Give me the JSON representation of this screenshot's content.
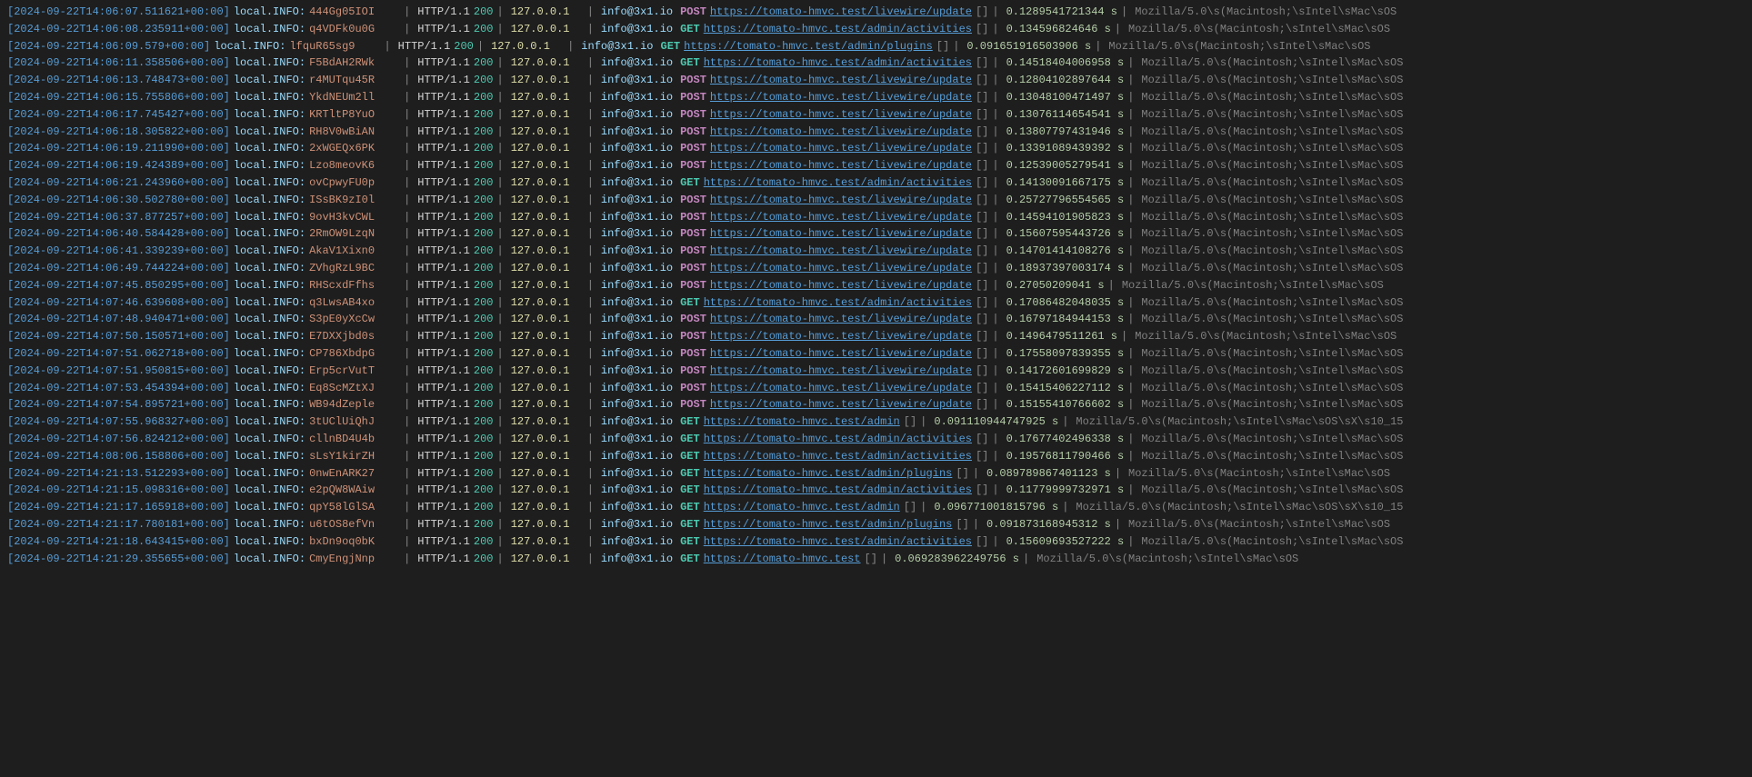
{
  "logs": [
    {
      "timestamp": "[2024-09-22T14:06:07.511621+00:00]",
      "level": "local.INFO:",
      "session": "444Gg05IOI",
      "http": "HTTP/1.1",
      "status": "200",
      "ip": "127.0.0.1",
      "domain": "info@3x1.io",
      "method": "POST",
      "url": "https://tomato-hmvc.test/livewire/update",
      "timing": "0.1289541721344 s",
      "ua": "Mozilla/5.0\\s(Macintosh;\\sIntel\\sMac\\sOS"
    },
    {
      "timestamp": "[2024-09-22T14:06:08.235911+00:00]",
      "level": "local.INFO:",
      "session": "q4VDFk0u0G",
      "http": "HTTP/1.1",
      "status": "200",
      "ip": "127.0.0.1",
      "domain": "info@3x1.io",
      "method": "GET",
      "url": "https://tomato-hmvc.test/admin/activities",
      "timing": "0.134596824646 s",
      "ua": "Mozilla/5.0\\s(Macintosh;\\sIntel\\sMac\\sOS"
    },
    {
      "timestamp": "[2024-09-22T14:06:09.579+00:00]",
      "level": "local.INFO:",
      "session": "lfquR65sg9",
      "http": "HTTP/1.1",
      "status": "200",
      "ip": "127.0.0.1",
      "domain": "info@3x1.io",
      "method": "GET",
      "url": "https://tomato-hmvc.test/admin/plugins",
      "timing": "0.091651916503906 s",
      "ua": "Mozilla/5.0\\s(Macintosh;\\sIntel\\sMac\\sOS"
    },
    {
      "timestamp": "[2024-09-22T14:06:11.358506+00:00]",
      "level": "local.INFO:",
      "session": "F5BdAH2RWk",
      "http": "HTTP/1.1",
      "status": "200",
      "ip": "127.0.0.1",
      "domain": "info@3x1.io",
      "method": "GET",
      "url": "https://tomato-hmvc.test/admin/activities",
      "timing": "0.14518404006958 s",
      "ua": "Mozilla/5.0\\s(Macintosh;\\sIntel\\sMac\\sOS"
    },
    {
      "timestamp": "[2024-09-22T14:06:13.748473+00:00]",
      "level": "local.INFO:",
      "session": "r4MUTqu45R",
      "http": "HTTP/1.1",
      "status": "200",
      "ip": "127.0.0.1",
      "domain": "info@3x1.io",
      "method": "POST",
      "url": "https://tomato-hmvc.test/livewire/update",
      "timing": "0.12804102897644 s",
      "ua": "Mozilla/5.0\\s(Macintosh;\\sIntel\\sMac\\sOS"
    },
    {
      "timestamp": "[2024-09-22T14:06:15.755806+00:00]",
      "level": "local.INFO:",
      "session": "YkdNEUm2ll",
      "http": "HTTP/1.1",
      "status": "200",
      "ip": "127.0.0.1",
      "domain": "info@3x1.io",
      "method": "POST",
      "url": "https://tomato-hmvc.test/livewire/update",
      "timing": "0.13048100471497 s",
      "ua": "Mozilla/5.0\\s(Macintosh;\\sIntel\\sMac\\sOS"
    },
    {
      "timestamp": "[2024-09-22T14:06:17.745427+00:00]",
      "level": "local.INFO:",
      "session": "KRTltP8YuO",
      "http": "HTTP/1.1",
      "status": "200",
      "ip": "127.0.0.1",
      "domain": "info@3x1.io",
      "method": "POST",
      "url": "https://tomato-hmvc.test/livewire/update",
      "timing": "0.13076114654541 s",
      "ua": "Mozilla/5.0\\s(Macintosh;\\sIntel\\sMac\\sOS"
    },
    {
      "timestamp": "[2024-09-22T14:06:18.305822+00:00]",
      "level": "local.INFO:",
      "session": "RH8V0wBiAN",
      "http": "HTTP/1.1",
      "status": "200",
      "ip": "127.0.0.1",
      "domain": "info@3x1.io",
      "method": "POST",
      "url": "https://tomato-hmvc.test/livewire/update",
      "timing": "0.13807797431946 s",
      "ua": "Mozilla/5.0\\s(Macintosh;\\sIntel\\sMac\\sOS"
    },
    {
      "timestamp": "[2024-09-22T14:06:19.211990+00:00]",
      "level": "local.INFO:",
      "session": "2xWGEQx6PK",
      "http": "HTTP/1.1",
      "status": "200",
      "ip": "127.0.0.1",
      "domain": "info@3x1.io",
      "method": "POST",
      "url": "https://tomato-hmvc.test/livewire/update",
      "timing": "0.13391089439392 s",
      "ua": "Mozilla/5.0\\s(Macintosh;\\sIntel\\sMac\\sOS"
    },
    {
      "timestamp": "[2024-09-22T14:06:19.424389+00:00]",
      "level": "local.INFO:",
      "session": "Lzo8meovK6",
      "http": "HTTP/1.1",
      "status": "200",
      "ip": "127.0.0.1",
      "domain": "info@3x1.io",
      "method": "POST",
      "url": "https://tomato-hmvc.test/livewire/update",
      "timing": "0.12539005279541 s",
      "ua": "Mozilla/5.0\\s(Macintosh;\\sIntel\\sMac\\sOS"
    },
    {
      "timestamp": "[2024-09-22T14:06:21.243960+00:00]",
      "level": "local.INFO:",
      "session": "ovCpwyFU0p",
      "http": "HTTP/1.1",
      "status": "200",
      "ip": "127.0.0.1",
      "domain": "info@3x1.io",
      "method": "GET",
      "url": "https://tomato-hmvc.test/admin/activities",
      "timing": "0.14130091667175 s",
      "ua": "Mozilla/5.0\\s(Macintosh;\\sIntel\\sMac\\sOS"
    },
    {
      "timestamp": "[2024-09-22T14:06:30.502780+00:00]",
      "level": "local.INFO:",
      "session": "ISsBK9zI0l",
      "http": "HTTP/1.1",
      "status": "200",
      "ip": "127.0.0.1",
      "domain": "info@3x1.io",
      "method": "POST",
      "url": "https://tomato-hmvc.test/livewire/update",
      "timing": "0.25727796554565 s",
      "ua": "Mozilla/5.0\\s(Macintosh;\\sIntel\\sMac\\sOS"
    },
    {
      "timestamp": "[2024-09-22T14:06:37.877257+00:00]",
      "level": "local.INFO:",
      "session": "9ovH3kvCWL",
      "http": "HTTP/1.1",
      "status": "200",
      "ip": "127.0.0.1",
      "domain": "info@3x1.io",
      "method": "POST",
      "url": "https://tomato-hmvc.test/livewire/update",
      "timing": "0.14594101905823 s",
      "ua": "Mozilla/5.0\\s(Macintosh;\\sIntel\\sMac\\sOS"
    },
    {
      "timestamp": "[2024-09-22T14:06:40.584428+00:00]",
      "level": "local.INFO:",
      "session": "2RmOW9LzqN",
      "http": "HTTP/1.1",
      "status": "200",
      "ip": "127.0.0.1",
      "domain": "info@3x1.io",
      "method": "POST",
      "url": "https://tomato-hmvc.test/livewire/update",
      "timing": "0.15607595443726 s",
      "ua": "Mozilla/5.0\\s(Macintosh;\\sIntel\\sMac\\sOS"
    },
    {
      "timestamp": "[2024-09-22T14:06:41.339239+00:00]",
      "level": "local.INFO:",
      "session": "AkaV1Xixn0",
      "http": "HTTP/1.1",
      "status": "200",
      "ip": "127.0.0.1",
      "domain": "info@3x1.io",
      "method": "POST",
      "url": "https://tomato-hmvc.test/livewire/update",
      "timing": "0.14701414108276 s",
      "ua": "Mozilla/5.0\\s(Macintosh;\\sIntel\\sMac\\sOS"
    },
    {
      "timestamp": "[2024-09-22T14:06:49.744224+00:00]",
      "level": "local.INFO:",
      "session": "ZVhgRzL9BC",
      "http": "HTTP/1.1",
      "status": "200",
      "ip": "127.0.0.1",
      "domain": "info@3x1.io",
      "method": "POST",
      "url": "https://tomato-hmvc.test/livewire/update",
      "timing": "0.18937397003174 s",
      "ua": "Mozilla/5.0\\s(Macintosh;\\sIntel\\sMac\\sOS"
    },
    {
      "timestamp": "[2024-09-22T14:07:45.850295+00:00]",
      "level": "local.INFO:",
      "session": "RHScxdFfhs",
      "http": "HTTP/1.1",
      "status": "200",
      "ip": "127.0.0.1",
      "domain": "info@3x1.io",
      "method": "POST",
      "url": "https://tomato-hmvc.test/livewire/update",
      "timing": "0.27050209041 s",
      "ua": "Mozilla/5.0\\s(Macintosh;\\sIntel\\sMac\\sOS"
    },
    {
      "timestamp": "[2024-09-22T14:07:46.639608+00:00]",
      "level": "local.INFO:",
      "session": "q3LwsAB4xo",
      "http": "HTTP/1.1",
      "status": "200",
      "ip": "127.0.0.1",
      "domain": "info@3x1.io",
      "method": "GET",
      "url": "https://tomato-hmvc.test/admin/activities",
      "timing": "0.17086482048035 s",
      "ua": "Mozilla/5.0\\s(Macintosh;\\sIntel\\sMac\\sOS"
    },
    {
      "timestamp": "[2024-09-22T14:07:48.940471+00:00]",
      "level": "local.INFO:",
      "session": "S3pE0yXcCw",
      "http": "HTTP/1.1",
      "status": "200",
      "ip": "127.0.0.1",
      "domain": "info@3x1.io",
      "method": "POST",
      "url": "https://tomato-hmvc.test/livewire/update",
      "timing": "0.16797184944153 s",
      "ua": "Mozilla/5.0\\s(Macintosh;\\sIntel\\sMac\\sOS"
    },
    {
      "timestamp": "[2024-09-22T14:07:50.150571+00:00]",
      "level": "local.INFO:",
      "session": "E7DXXjbd0s",
      "http": "HTTP/1.1",
      "status": "200",
      "ip": "127.0.0.1",
      "domain": "info@3x1.io",
      "method": "POST",
      "url": "https://tomato-hmvc.test/livewire/update",
      "timing": "0.1496479511261 s",
      "ua": "Mozilla/5.0\\s(Macintosh;\\sIntel\\sMac\\sOS"
    },
    {
      "timestamp": "[2024-09-22T14:07:51.062718+00:00]",
      "level": "local.INFO:",
      "session": "CP786XbdpG",
      "http": "HTTP/1.1",
      "status": "200",
      "ip": "127.0.0.1",
      "domain": "info@3x1.io",
      "method": "POST",
      "url": "https://tomato-hmvc.test/livewire/update",
      "timing": "0.17558097839355 s",
      "ua": "Mozilla/5.0\\s(Macintosh;\\sIntel\\sMac\\sOS"
    },
    {
      "timestamp": "[2024-09-22T14:07:51.950815+00:00]",
      "level": "local.INFO:",
      "session": "Erp5crVutT",
      "http": "HTTP/1.1",
      "status": "200",
      "ip": "127.0.0.1",
      "domain": "info@3x1.io",
      "method": "POST",
      "url": "https://tomato-hmvc.test/livewire/update",
      "timing": "0.14172601699829 s",
      "ua": "Mozilla/5.0\\s(Macintosh;\\sIntel\\sMac\\sOS"
    },
    {
      "timestamp": "[2024-09-22T14:07:53.454394+00:00]",
      "level": "local.INFO:",
      "session": "Eq8ScMZtXJ",
      "http": "HTTP/1.1",
      "status": "200",
      "ip": "127.0.0.1",
      "domain": "info@3x1.io",
      "method": "POST",
      "url": "https://tomato-hmvc.test/livewire/update",
      "timing": "0.15415406227112 s",
      "ua": "Mozilla/5.0\\s(Macintosh;\\sIntel\\sMac\\sOS"
    },
    {
      "timestamp": "[2024-09-22T14:07:54.895721+00:00]",
      "level": "local.INFO:",
      "session": "WB94dZeple",
      "http": "HTTP/1.1",
      "status": "200",
      "ip": "127.0.0.1",
      "domain": "info@3x1.io",
      "method": "POST",
      "url": "https://tomato-hmvc.test/livewire/update",
      "timing": "0.15155410766602 s",
      "ua": "Mozilla/5.0\\s(Macintosh;\\sIntel\\sMac\\sOS"
    },
    {
      "timestamp": "[2024-09-22T14:07:55.968327+00:00]",
      "level": "local.INFO:",
      "session": "3tUClUiQhJ",
      "http": "HTTP/1.1",
      "status": "200",
      "ip": "127.0.0.1",
      "domain": "info@3x1.io",
      "method": "GET",
      "url": "https://tomato-hmvc.test/admin",
      "timing": "0.091110944747925 s",
      "ua": "Mozilla/5.0\\s(Macintosh;\\sIntel\\sMac\\sOS\\sX\\s10_15"
    },
    {
      "timestamp": "[2024-09-22T14:07:56.824212+00:00]",
      "level": "local.INFO:",
      "session": "cllnBD4U4b",
      "http": "HTTP/1.1",
      "status": "200",
      "ip": "127.0.0.1",
      "domain": "info@3x1.io",
      "method": "GET",
      "url": "https://tomato-hmvc.test/admin/activities",
      "timing": "0.17677402496338 s",
      "ua": "Mozilla/5.0\\s(Macintosh;\\sIntel\\sMac\\sOS"
    },
    {
      "timestamp": "[2024-09-22T14:08:06.158806+00:00]",
      "level": "local.INFO:",
      "session": "sLsY1kirZH",
      "http": "HTTP/1.1",
      "status": "200",
      "ip": "127.0.0.1",
      "domain": "info@3x1.io",
      "method": "GET",
      "url": "https://tomato-hmvc.test/admin/activities",
      "timing": "0.19576811790466 s",
      "ua": "Mozilla/5.0\\s(Macintosh;\\sIntel\\sMac\\sOS"
    },
    {
      "timestamp": "[2024-09-22T14:21:13.512293+00:00]",
      "level": "local.INFO:",
      "session": "0nwEnARK27",
      "http": "HTTP/1.1",
      "status": "200",
      "ip": "127.0.0.1",
      "domain": "info@3x1.io",
      "method": "GET",
      "url": "https://tomato-hmvc.test/admin/plugins",
      "timing": "0.089789867401123 s",
      "ua": "Mozilla/5.0\\s(Macintosh;\\sIntel\\sMac\\sOS"
    },
    {
      "timestamp": "[2024-09-22T14:21:15.098316+00:00]",
      "level": "local.INFO:",
      "session": "e2pQW8WAiw",
      "http": "HTTP/1.1",
      "status": "200",
      "ip": "127.0.0.1",
      "domain": "info@3x1.io",
      "method": "GET",
      "url": "https://tomato-hmvc.test/admin/activities",
      "timing": "0.11779999732971 s",
      "ua": "Mozilla/5.0\\s(Macintosh;\\sIntel\\sMac\\sOS"
    },
    {
      "timestamp": "[2024-09-22T14:21:17.165918+00:00]",
      "level": "local.INFO:",
      "session": "qpY58lGlSA",
      "http": "HTTP/1.1",
      "status": "200",
      "ip": "127.0.0.1",
      "domain": "info@3x1.io",
      "method": "GET",
      "url": "https://tomato-hmvc.test/admin",
      "timing": "0.096771001815796 s",
      "ua": "Mozilla/5.0\\s(Macintosh;\\sIntel\\sMac\\sOS\\sX\\s10_15"
    },
    {
      "timestamp": "[2024-09-22T14:21:17.780181+00:00]",
      "level": "local.INFO:",
      "session": "u6tOS8efVn",
      "http": "HTTP/1.1",
      "status": "200",
      "ip": "127.0.0.1",
      "domain": "info@3x1.io",
      "method": "GET",
      "url": "https://tomato-hmvc.test/admin/plugins",
      "timing": "0.091873168945312 s",
      "ua": "Mozilla/5.0\\s(Macintosh;\\sIntel\\sMac\\sOS"
    },
    {
      "timestamp": "[2024-09-22T14:21:18.643415+00:00]",
      "level": "local.INFO:",
      "session": "bxDn9oq0bK",
      "http": "HTTP/1.1",
      "status": "200",
      "ip": "127.0.0.1",
      "domain": "info@3x1.io",
      "method": "GET",
      "url": "https://tomato-hmvc.test/admin/activities",
      "timing": "0.15609693527222 s",
      "ua": "Mozilla/5.0\\s(Macintosh;\\sIntel\\sMac\\sOS"
    },
    {
      "timestamp": "[2024-09-22T14:21:29.355655+00:00]",
      "level": "local.INFO:",
      "session": "CmyEngjNnp",
      "http": "HTTP/1.1",
      "status": "200",
      "ip": "127.0.0.1",
      "domain": "info@3x1.io",
      "method": "GET",
      "url": "https://tomato-hmvc.test",
      "timing": "0.069283962249756 s",
      "ua": "Mozilla/5.0\\s(Macintosh;\\sIntel\\sMac\\sOS"
    }
  ]
}
